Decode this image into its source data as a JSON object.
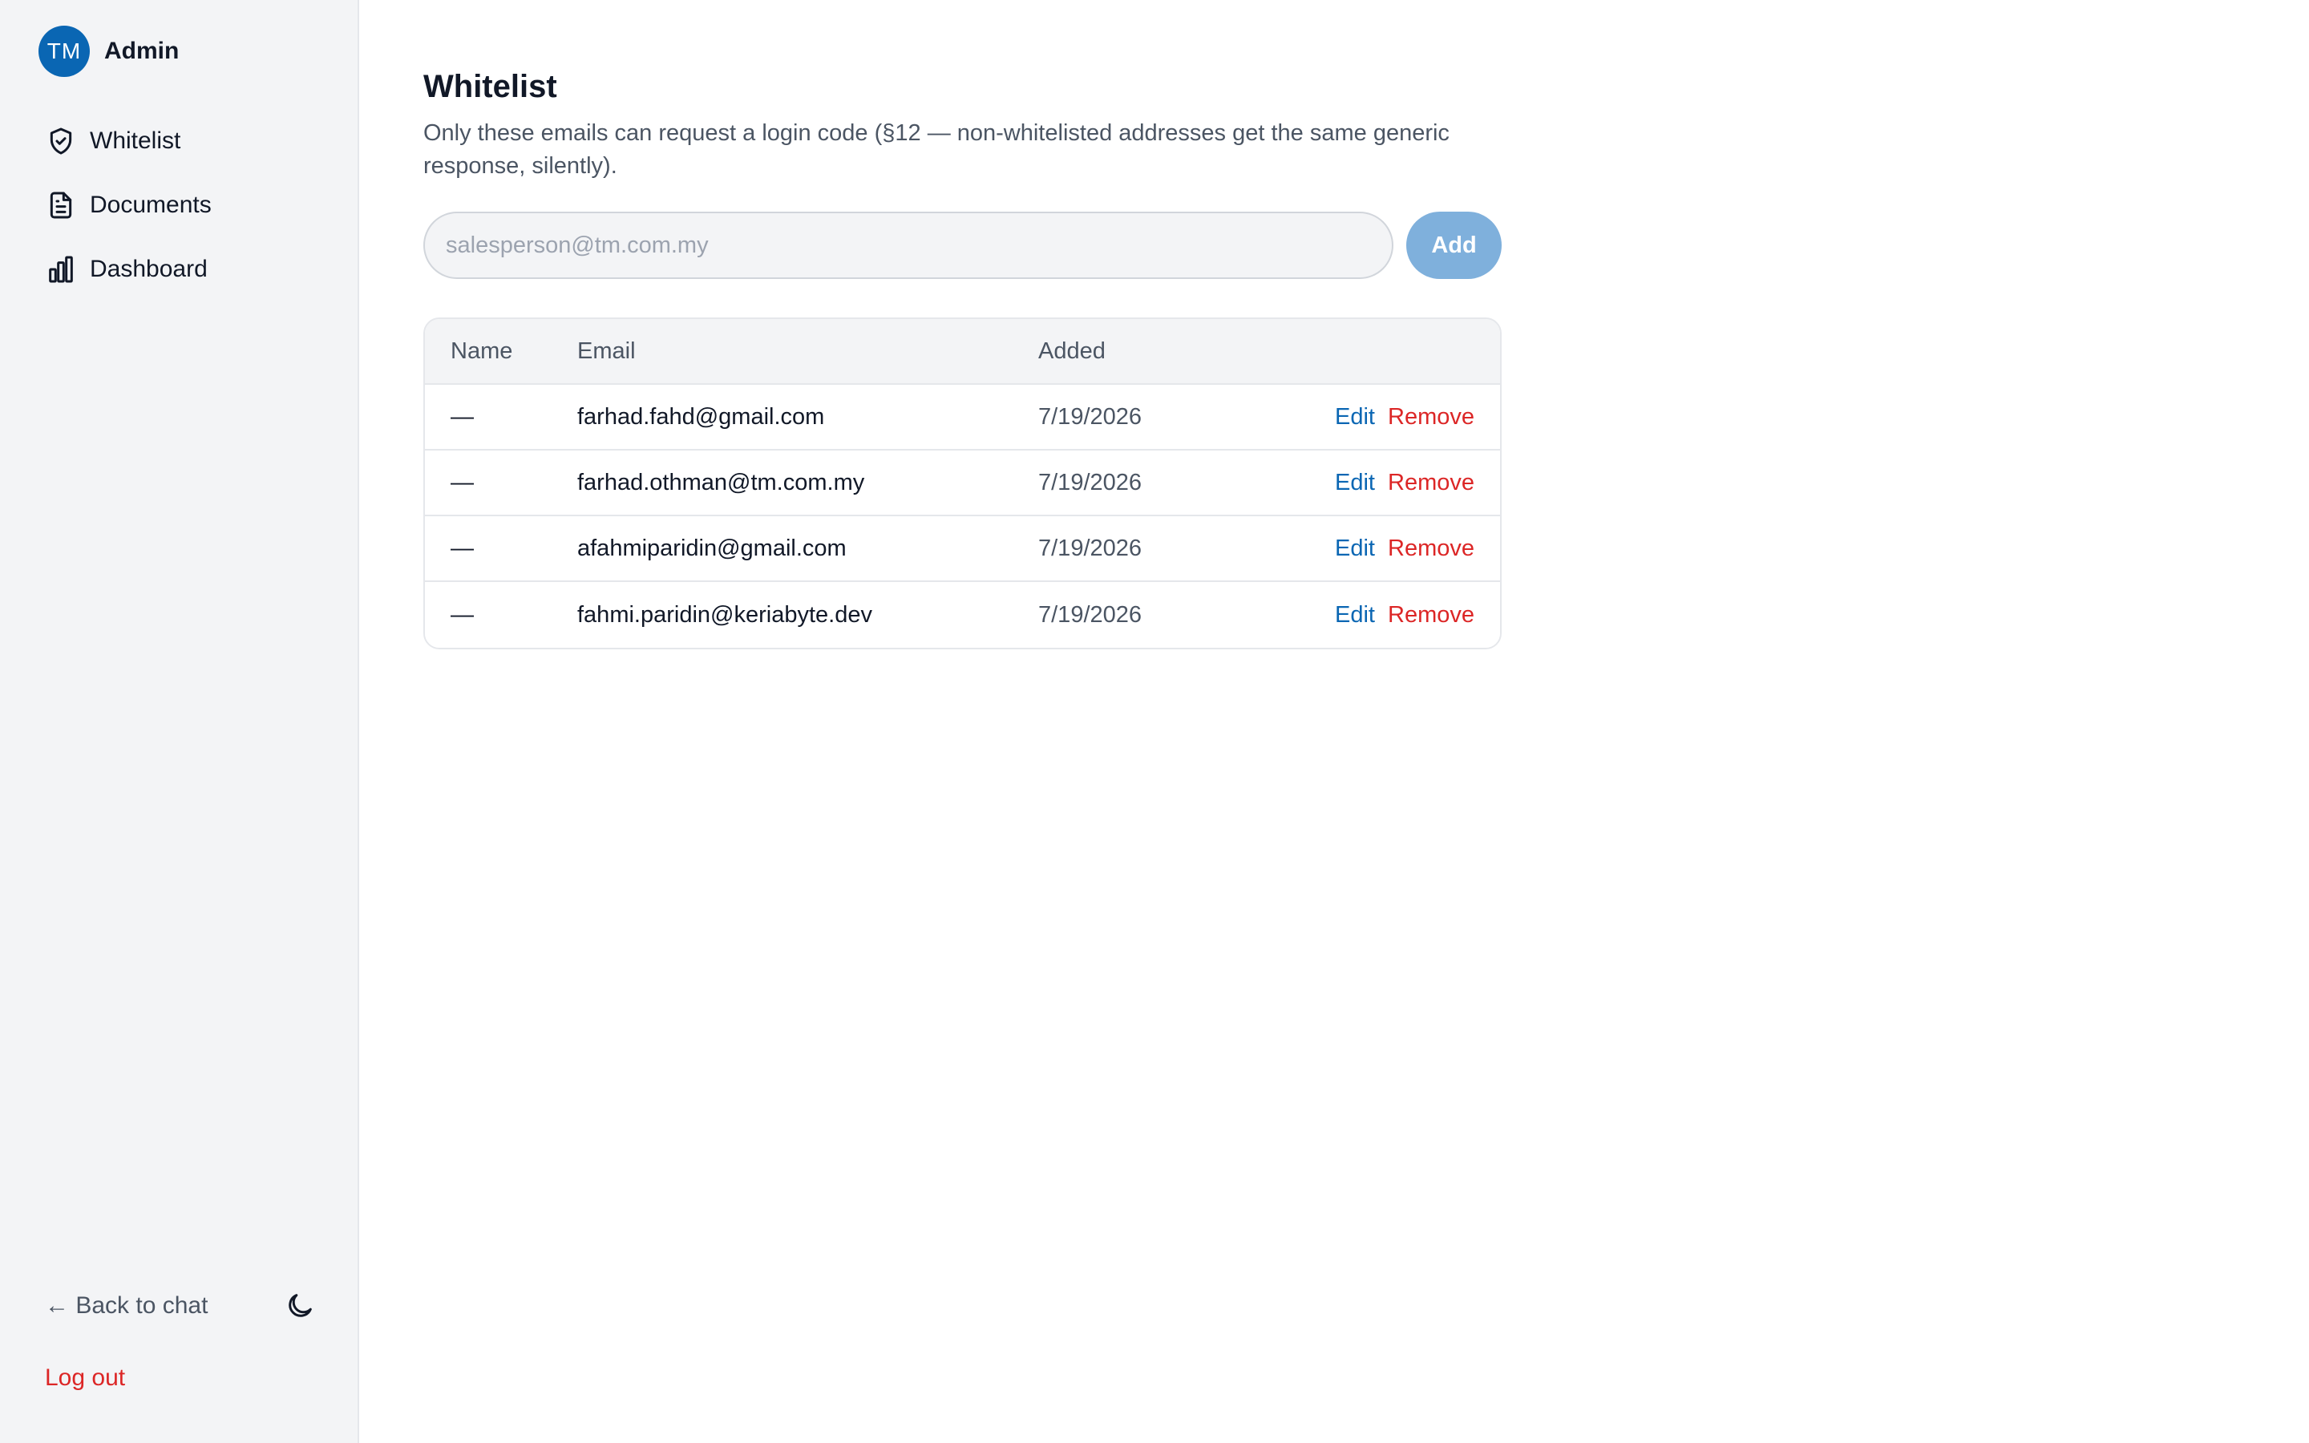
{
  "brand": {
    "initials": "TM",
    "name": "Admin",
    "avatar_color": "#0a66b3"
  },
  "sidebar": {
    "items": [
      {
        "label": "Whitelist",
        "icon": "shield-check-icon"
      },
      {
        "label": "Documents",
        "icon": "document-icon"
      },
      {
        "label": "Dashboard",
        "icon": "bar-chart-icon"
      }
    ],
    "back_label": "← Back to chat",
    "theme_icon": "moon-icon",
    "logout_label": "Log out"
  },
  "main": {
    "title": "Whitelist",
    "subtitle": "Only these emails can request a login code (§12 — non-whitelisted addresses get the same generic response, silently).",
    "input": {
      "placeholder": "salesperson@tm.com.my",
      "value": ""
    },
    "add_label": "Add",
    "table": {
      "headers": {
        "name": "Name",
        "email": "Email",
        "added": "Added"
      },
      "rows": [
        {
          "name": "—",
          "email": "farhad.fahd@gmail.com",
          "added": "7/19/2026",
          "edit": "Edit",
          "remove": "Remove"
        },
        {
          "name": "—",
          "email": "farhad.othman@tm.com.my",
          "added": "7/19/2026",
          "edit": "Edit",
          "remove": "Remove"
        },
        {
          "name": "—",
          "email": "afahmiparidin@gmail.com",
          "added": "7/19/2026",
          "edit": "Edit",
          "remove": "Remove"
        },
        {
          "name": "—",
          "email": "fahmi.paridin@keriabyte.dev",
          "added": "7/19/2026",
          "edit": "Edit",
          "remove": "Remove"
        }
      ]
    }
  },
  "colors": {
    "accent": "#0a66b3",
    "danger": "#dc2626",
    "add_button": "#7fb0dc",
    "sidebar_bg": "#f3f4f6"
  }
}
